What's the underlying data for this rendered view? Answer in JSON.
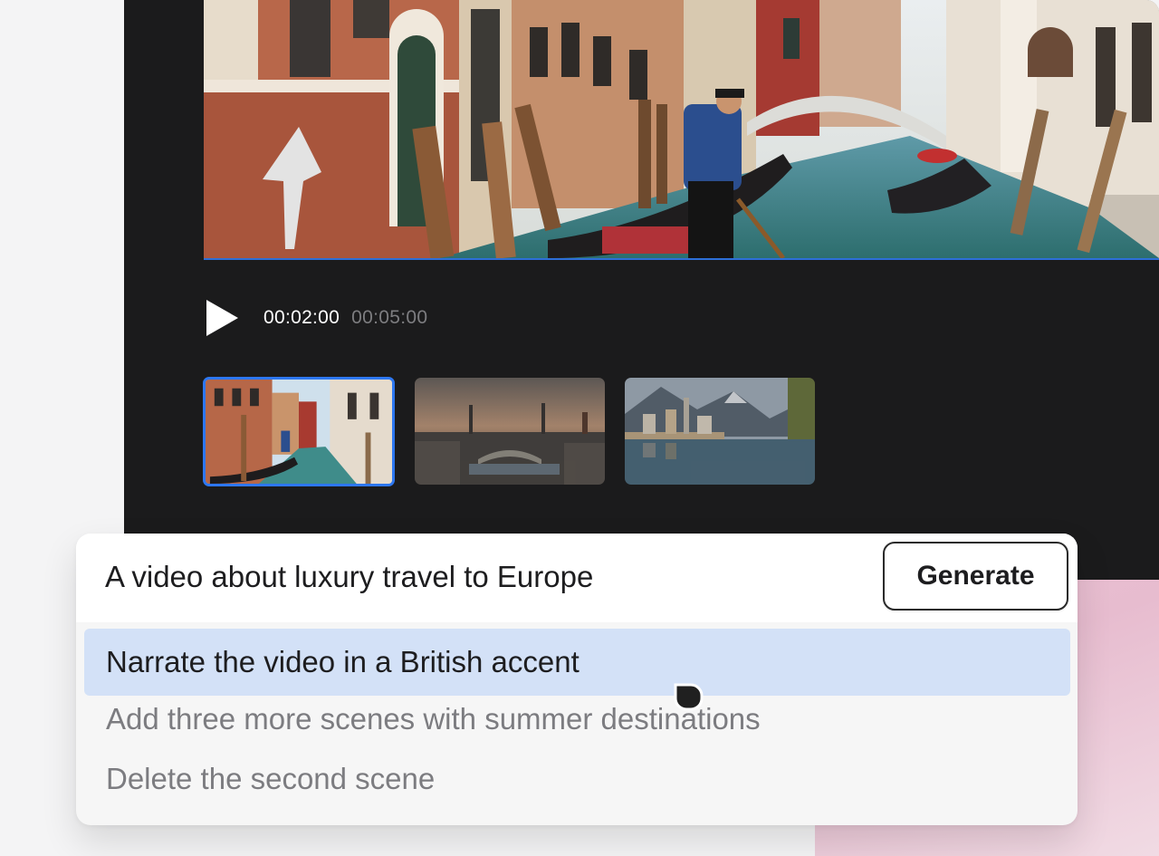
{
  "player": {
    "current_time": "00:02:00",
    "total_time": "00:05:00",
    "play_icon": "play-icon"
  },
  "scenes": [
    {
      "name": "Venice canal scene",
      "selected": true
    },
    {
      "name": "City skyline at dusk scene",
      "selected": false
    },
    {
      "name": "Lakeside alpine town scene",
      "selected": false
    }
  ],
  "prompt": {
    "text": "A video about luxury travel to Europe",
    "generate_label": "Generate"
  },
  "suggestions": [
    {
      "label": "Narrate the video in a British accent",
      "highlighted": true
    },
    {
      "label": "Add three more scenes with summer destinations",
      "highlighted": false
    },
    {
      "label": "Delete the second scene",
      "highlighted": false
    }
  ],
  "colors": {
    "panel_bg": "#1b1b1c",
    "accent_blue": "#2d77f0",
    "highlight_bg": "#d3e1f7",
    "pink_wash": "#ecc3d4"
  }
}
